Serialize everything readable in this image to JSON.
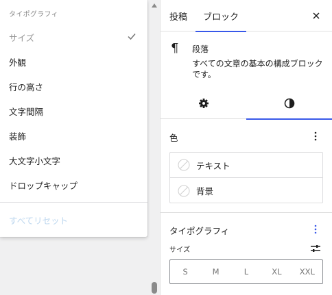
{
  "menu": {
    "heading": "タイポグラフィ",
    "items": [
      {
        "label": "サイズ",
        "checked": true
      },
      {
        "label": "外観",
        "checked": false
      },
      {
        "label": "行の高さ",
        "checked": false
      },
      {
        "label": "文字間隔",
        "checked": false
      },
      {
        "label": "装飾",
        "checked": false
      },
      {
        "label": "大文字小文字",
        "checked": false
      },
      {
        "label": "ドロップキャップ",
        "checked": false
      }
    ],
    "reset_label": "すべてリセット"
  },
  "sidebar": {
    "tabs": {
      "post": "投稿",
      "block": "ブロック"
    },
    "block": {
      "title": "段落",
      "description": "すべての文章の基本の構成ブロックです。",
      "icon": "¶"
    },
    "color_panel": {
      "title": "色",
      "rows": [
        {
          "label": "テキスト"
        },
        {
          "label": "背景"
        }
      ]
    },
    "typography_panel": {
      "title": "タイポグラフィ",
      "size_label": "サイズ",
      "sizes": [
        "S",
        "M",
        "L",
        "XL",
        "XXL"
      ]
    }
  },
  "colors": {
    "accent": "#3858e9",
    "disabled_text": "#bdd7ef"
  }
}
